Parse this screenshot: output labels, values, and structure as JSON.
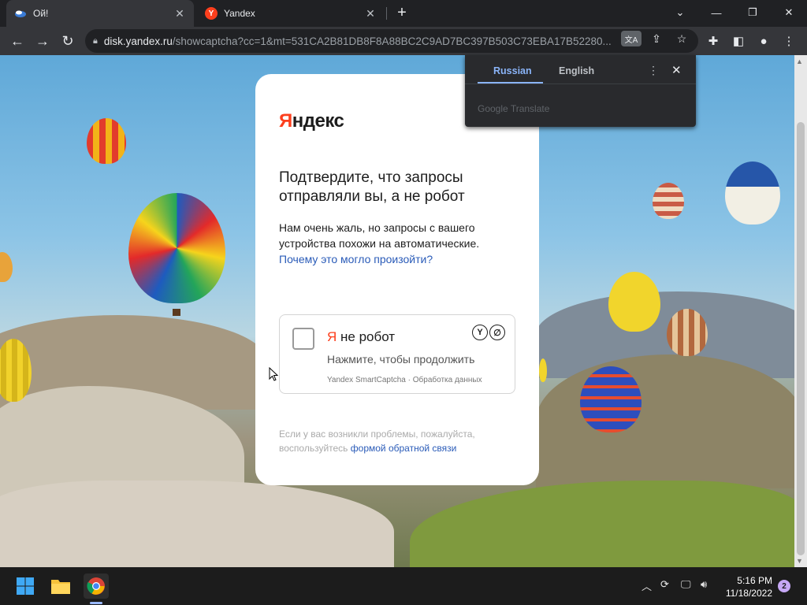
{
  "browser": {
    "tabs": [
      {
        "title": "Ой!",
        "icon": "yandex-disk-icon",
        "active": true
      },
      {
        "title": "Yandex",
        "icon": "yandex-icon",
        "active": false
      }
    ],
    "new_tab_label": "+",
    "url_host": "disk.yandex.ru",
    "url_path": "/showcaptcha?cc=1&mt=531CA2B81DB8F8A88BC2C9AD7BC397B503C73EBA17B52280..."
  },
  "translate_popup": {
    "tabs": [
      "Russian",
      "English"
    ],
    "active_tab": "Russian",
    "brand": "Google Translate"
  },
  "captcha_page": {
    "logo_first": "Я",
    "logo_rest": "ндекс",
    "heading": "Подтвердите, что запросы отправляли вы, а не робот",
    "description": "Нам очень жаль, но запросы с вашего устройства похожи на автоматические.",
    "why_link": "Почему это могло произойти?",
    "checkbox_label_prefix": "Я",
    "checkbox_label_rest": " не робот",
    "checkbox_hint": "Нажмите, чтобы продолжить",
    "captcha_footer": "Yandex SmartCaptcha · Обработка данных",
    "problem_note": "Если у вас возникли проблемы, пожалуйста, воспользуйтесь",
    "feedback_link": "формой обратной связи"
  },
  "taskbar": {
    "time": "5:16 PM",
    "date": "11/18/2022",
    "notification_count": "2"
  },
  "colors": {
    "yandex_red": "#fc3f1d",
    "link_blue": "#2a5bb8",
    "chrome_dark": "#202124",
    "translate_accent": "#8ab4f8"
  }
}
